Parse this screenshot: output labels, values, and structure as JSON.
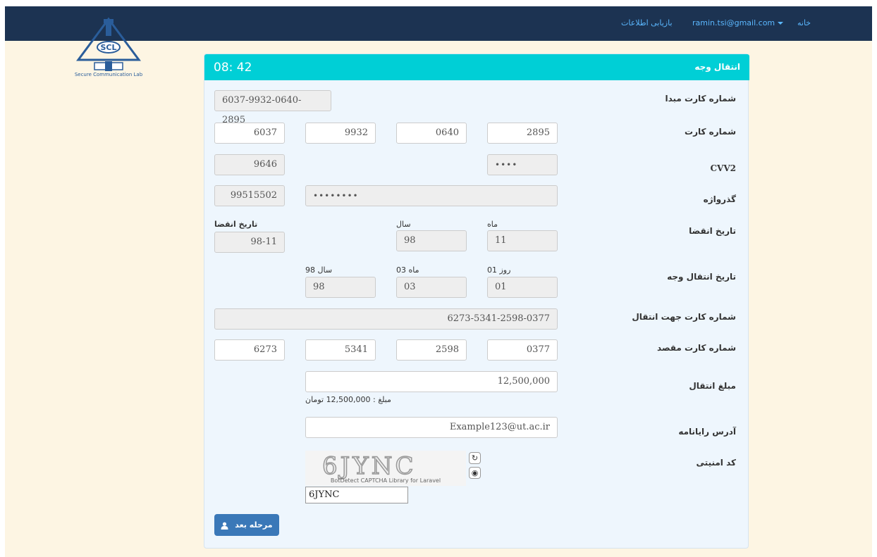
{
  "nav": {
    "home": "خانه",
    "user_email": "ramin.tsi@gmail.com",
    "recover": "بازیابی اطلاعات"
  },
  "logo": {
    "caption": "Secure Communication Lab",
    "letters": "SCL"
  },
  "panel": {
    "timer": "08: 42",
    "title": "انتقال وجه"
  },
  "form": {
    "source_card": {
      "label": "شماره کارت مبدا",
      "value": "6037-9932-0640-2895"
    },
    "card_number": {
      "label": "شماره کارت",
      "parts": [
        "6037",
        "9932",
        "0640",
        "2895"
      ]
    },
    "cvv2": {
      "label": "CVV2",
      "masked": "••••",
      "value": "9646"
    },
    "password": {
      "label": "گذرواژه",
      "masked": "••••••••",
      "value": "99515502"
    },
    "expiry": {
      "label": "تاریخ انقضا",
      "month_label": "ماه",
      "month": "11",
      "year_label": "سال",
      "year": "98",
      "combined_label": "تاریخ انقضا",
      "combined": "98-11"
    },
    "transfer_date": {
      "label": "تاریخ انتقال وجه",
      "day_label": "روز 01",
      "day": "01",
      "month_label": "ماه 03",
      "month": "03",
      "year_label": "سال 98",
      "year": "98"
    },
    "dest_card_full": {
      "label": "شماره کارت جهت انتقال",
      "value": "6273-5341-2598-0377"
    },
    "dest_card": {
      "label": "شماره کارت مقصد",
      "parts": [
        "0377",
        "2598",
        "5341",
        "6273"
      ]
    },
    "amount": {
      "label": "مبلغ انتقال",
      "value": "12,500,000",
      "hint": "مبلغ : 12,500,000 تومان"
    },
    "email": {
      "label": "آدرس رایانامه",
      "value": "Example123@ut.ac.ir"
    },
    "captcha": {
      "label": "کد امنیتی",
      "image_text": "6JYNC",
      "footer": "BotDetect CAPTCHA Library for Laravel",
      "input": "6JYNC"
    }
  },
  "buttons": {
    "next": "مرحله بعد"
  },
  "icons": {
    "reload": "reload-icon",
    "sound": "sound-icon",
    "user": "user-icon"
  }
}
